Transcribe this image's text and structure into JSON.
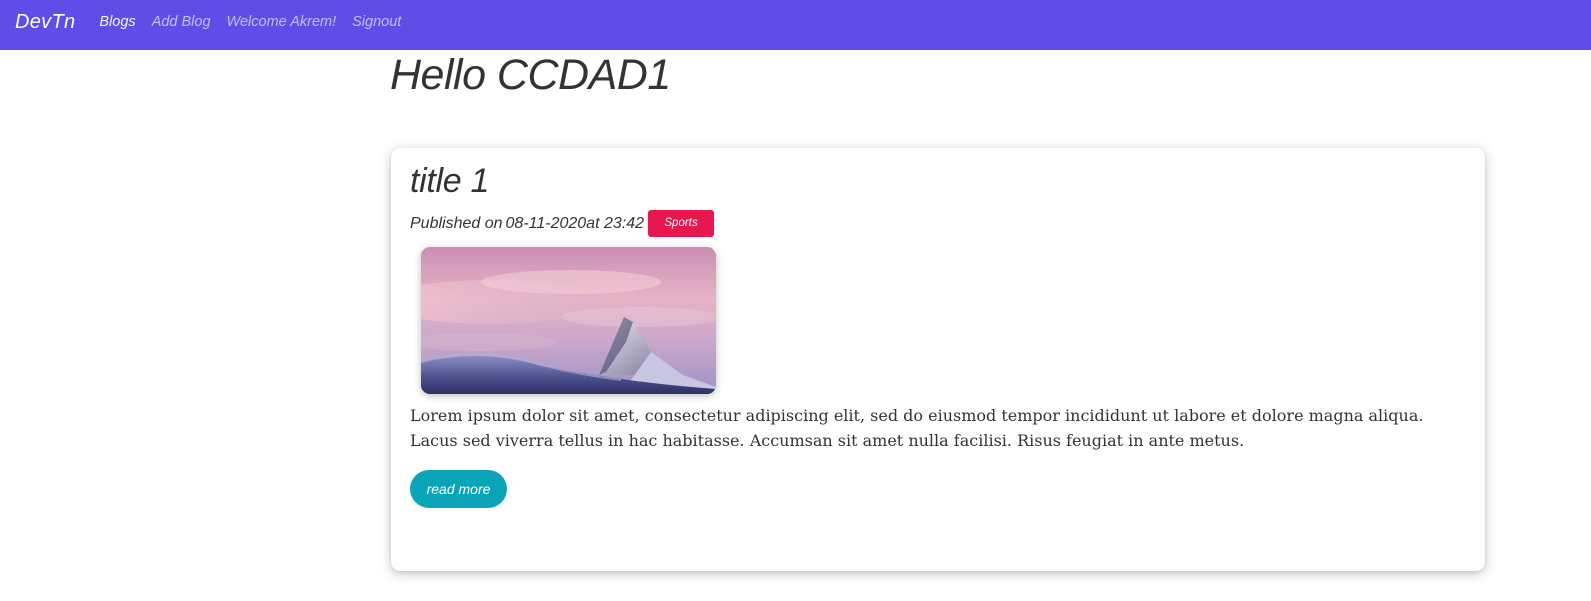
{
  "navbar": {
    "brand": "DevTn",
    "links": [
      {
        "label": "Blogs",
        "active": true
      },
      {
        "label": "Add Blog",
        "active": false
      },
      {
        "label": "Welcome Akrem!",
        "active": false
      },
      {
        "label": "Signout",
        "active": false
      }
    ],
    "background_color": "#5f4de8"
  },
  "main": {
    "greeting": "Hello CCDAD1"
  },
  "post": {
    "title": "title 1",
    "published_prefix": "Published on",
    "date": "08-11-2020",
    "time_text": "at 23:42",
    "category": "Sports",
    "category_color": "#e8174e",
    "image": "snowy-mountain-peak-sunset",
    "excerpt": "Lorem ipsum dolor sit amet, consectetur adipiscing elit, sed do eiusmod tempor incididunt ut labore et dolore magna aliqua. Lacus sed viverra tellus in hac habitasse. Accumsan sit amet nulla facilisi. Risus feugiat in ante metus.",
    "read_more_label": "read more",
    "read_more_color": "#0aa4b8"
  }
}
